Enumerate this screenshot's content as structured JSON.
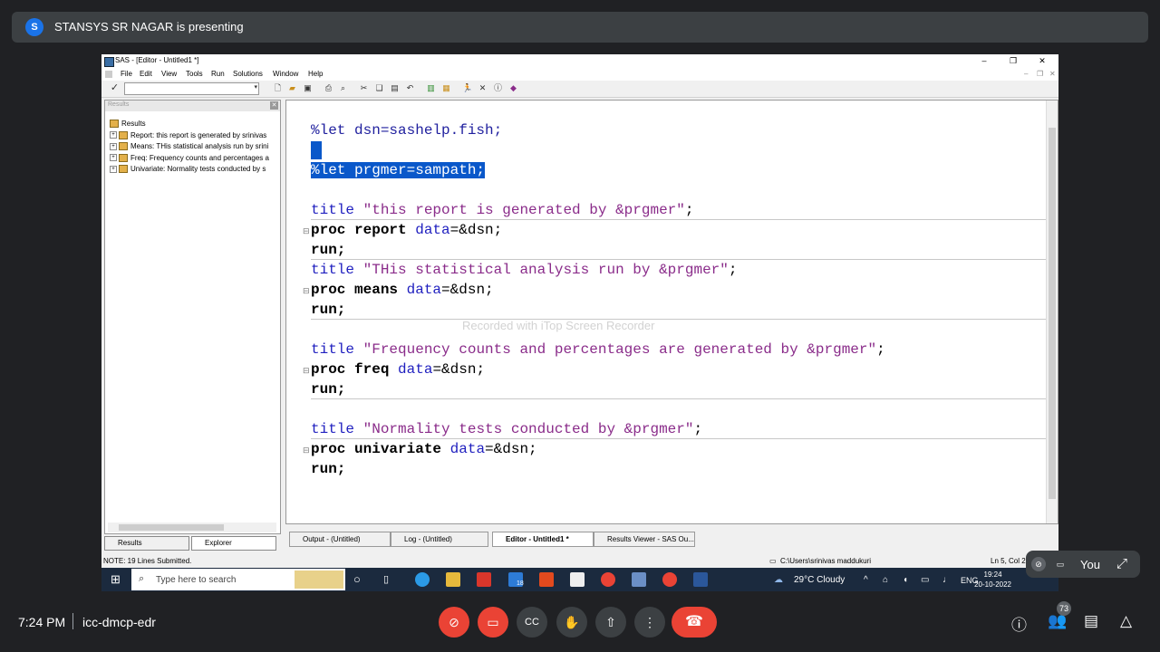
{
  "meet": {
    "presenter_initial": "S",
    "presenter_text": "STANSYS SR NAGAR is presenting",
    "time": "7:24 PM",
    "meeting_code": "icc-dmcp-edr",
    "self_label": "You",
    "participants_count": "73"
  },
  "sas": {
    "window_title": "SAS - [Editor - Untitled1 *]",
    "menu": [
      "File",
      "Edit",
      "View",
      "Tools",
      "Run",
      "Solutions",
      "Window",
      "Help"
    ],
    "results_panel_title": "Results",
    "results_root": "Results",
    "results_items": [
      "Report:  this report is generated by srinivas",
      "Means:  THis statistical analysis run by srini",
      "Freq:  Frequency counts and percentages a",
      "Univariate:  Normality tests conducted by s"
    ],
    "panel_tabs": [
      "Results",
      "Explorer"
    ],
    "code": {
      "l1": "%let dsn=sashelp.fish;",
      "l2": "%let prgmer=sampath;",
      "l3_kw": "title",
      "l3_str": " \"this report is generated by &prgmer\"",
      "l3_end": ";",
      "l4_kw": "proc report",
      "l4_opt": " data",
      "l4_end": "=&dsn;",
      "l5": "run;",
      "l6_kw": "title",
      "l6_str": " \"THis statistical analysis run by &prgmer\"",
      "l6_end": ";",
      "l7_kw": "proc means",
      "l7_opt": " data",
      "l7_end": "=&dsn;",
      "l8": "run;",
      "l9_kw": "title",
      "l9_str": " \"Frequency counts and percentages are generated by &prgmer\"",
      "l9_end": ";",
      "l10_kw": "proc freq",
      "l10_opt": " data",
      "l10_end": "=&dsn;",
      "l11": "run;",
      "l12_kw": "title",
      "l12_str": " \"Normality tests conducted by &prgmer\"",
      "l12_end": ";",
      "l13_kw": "proc univariate",
      "l13_opt": " data",
      "l13_end": "=&dsn;",
      "l14": "run;"
    },
    "watermark": "Recorded with iTop Screen Recorder",
    "window_tabs": [
      "Output - (Untitled)",
      "Log - (Untitled)",
      "Editor - Untitled1 *",
      "Results Viewer - SAS Ou..."
    ],
    "status_left": "NOTE: 19 Lines Submitted.",
    "status_path": "C:\\Users\\srinivas maddukuri",
    "status_pos": "Ln 5, Col 2"
  },
  "taskbar": {
    "search_placeholder": "Type here to search",
    "weather": "29°C  Cloudy",
    "lang": "ENG",
    "clock_time": "19:24",
    "clock_date": "20-10-2022",
    "mail_badge": "18"
  }
}
